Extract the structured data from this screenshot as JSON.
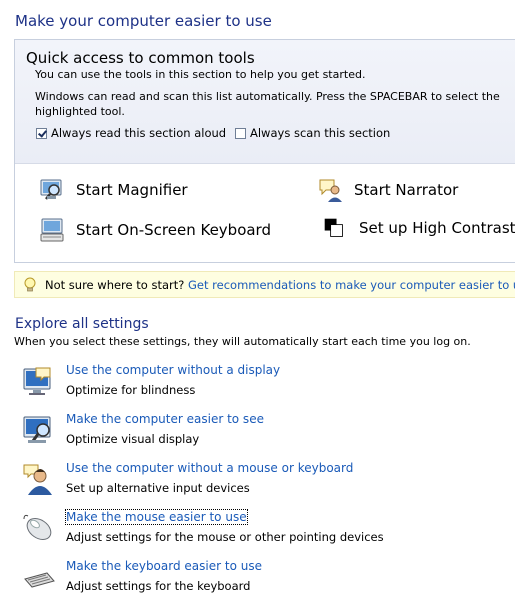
{
  "page_title": "Make your computer easier to use",
  "quick_access": {
    "title": "Quick access to common tools",
    "desc1": "You can use the tools in this section to help you get started.",
    "desc2": "Windows can read and scan this list automatically.  Press the SPACEBAR to select the highlighted tool.",
    "checkbox_read": {
      "label": "Always read this section aloud",
      "checked": true
    },
    "checkbox_scan": {
      "label": "Always scan this section",
      "checked": false
    },
    "tools": {
      "magnifier": {
        "label": "Start Magnifier",
        "icon": "magnifier-icon"
      },
      "narrator": {
        "label": "Start Narrator",
        "icon": "narrator-icon"
      },
      "keyboard": {
        "label": "Start On-Screen Keyboard",
        "icon": "onscreen-keyboard-icon"
      },
      "contrast": {
        "label": "Set up High Contrast",
        "icon": "high-contrast-icon"
      }
    }
  },
  "hint": {
    "prefix": "Not sure where to start?",
    "link": "Get recommendations to make your computer easier to use",
    "icon": "lightbulb-icon"
  },
  "explore": {
    "title": "Explore all settings",
    "desc": "When you select these settings, they will automatically start each time you log on.",
    "items": [
      {
        "link": "Use the computer without a display",
        "sub": "Optimize for blindness",
        "icon": "monitor-speech-icon"
      },
      {
        "link": "Make the computer easier to see",
        "sub": "Optimize visual display",
        "icon": "monitor-magnify-icon"
      },
      {
        "link": "Use the computer without a mouse or keyboard",
        "sub": "Set up alternative input devices",
        "icon": "user-speech-icon"
      },
      {
        "link": "Make the mouse easier to use",
        "sub": "Adjust settings for the mouse or other pointing devices",
        "icon": "mouse-icon"
      },
      {
        "link": "Make the keyboard easier to use",
        "sub": "Adjust settings for the keyboard",
        "icon": "keyboard-icon"
      }
    ]
  },
  "colors": {
    "heading": "#1e3287",
    "link": "#1a5ab8",
    "hint_bg": "#fefee1",
    "panel_bg": "#eef0f8"
  }
}
